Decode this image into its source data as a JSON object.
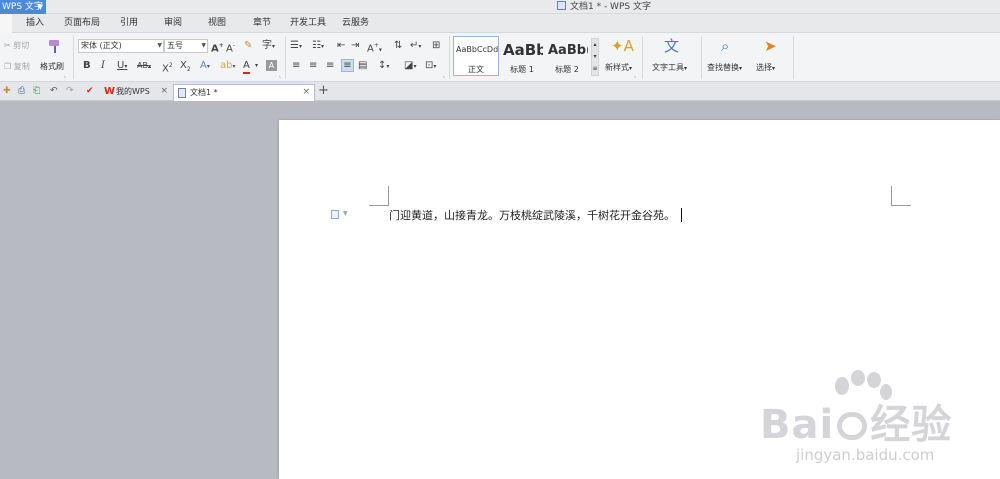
{
  "window": {
    "app_button": "WPS 文字",
    "title": "文档1 * - WPS 文字"
  },
  "menu": {
    "tabs": [
      "插入",
      "页面布局",
      "引用",
      "审阅",
      "视图",
      "章节",
      "开发工具",
      "云服务"
    ]
  },
  "ribbon": {
    "clipboard": {
      "cut": "剪切",
      "copy": "复制",
      "format_painter": "格式刷"
    },
    "font": {
      "name": "宋体 (正文)",
      "size": "五号"
    },
    "styles": [
      {
        "sample": "AaBbCcDd",
        "label": "正文"
      },
      {
        "sample": "AaBb",
        "label": "标题 1"
      },
      {
        "sample": "AaBb(",
        "label": "标题 2"
      }
    ],
    "new_style": "新样式",
    "text_tools": "文字工具",
    "find_replace": "查找替换",
    "select": "选择"
  },
  "doc_tabs": {
    "tabs": [
      {
        "label": "我的WPS"
      },
      {
        "label": "文档1 *"
      }
    ]
  },
  "document": {
    "text": "门迎黄道，山接青龙。万枝桃绽武陵溪，千树花开金谷苑。"
  },
  "watermark": {
    "brand": "Bai",
    "brand_cn": "经验",
    "url": "jingyan.baidu.com"
  },
  "colors": {
    "accent": "#4a8ad7",
    "wps_red": "#d9251d",
    "workspace": "#b7bac1",
    "ribbon_bg": "#f3f4f5"
  }
}
